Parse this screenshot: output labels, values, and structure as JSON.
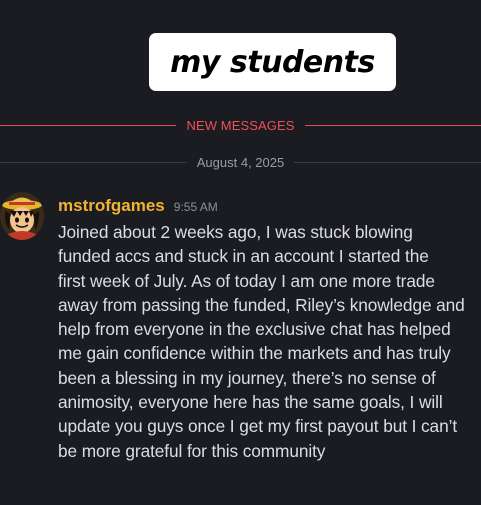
{
  "overlay": {
    "title": "my students"
  },
  "chat": {
    "new_messages_label": "NEW MESSAGES",
    "date_label": "August 4, 2025",
    "message": {
      "avatar_icon": "anime-character-straw-hat-avatar-icon",
      "username": "mstrofgames",
      "username_color": "#f0b232",
      "timestamp": "9:55 AM",
      "text": "Joined about 2 weeks ago, I was stuck blowing\nfunded accs and stuck in an account I started the\nfirst week of July. As of today I am one more trade\naway from passing the funded, Riley’s knowledge and\nhelp from everyone in the exclusive chat has helped\nme gain confidence within the markets and has truly\nbeen a blessing in my journey, there’s no sense of\nanimosity, everyone here has the same goals, I will\nupdate you guys once I get my first payout but I can’t\nbe more grateful for this  community"
    }
  },
  "colors": {
    "background": "#1b1c21",
    "new_messages_accent": "#f04f54",
    "divider": "#3a3b42",
    "text": "#dcdde2"
  }
}
